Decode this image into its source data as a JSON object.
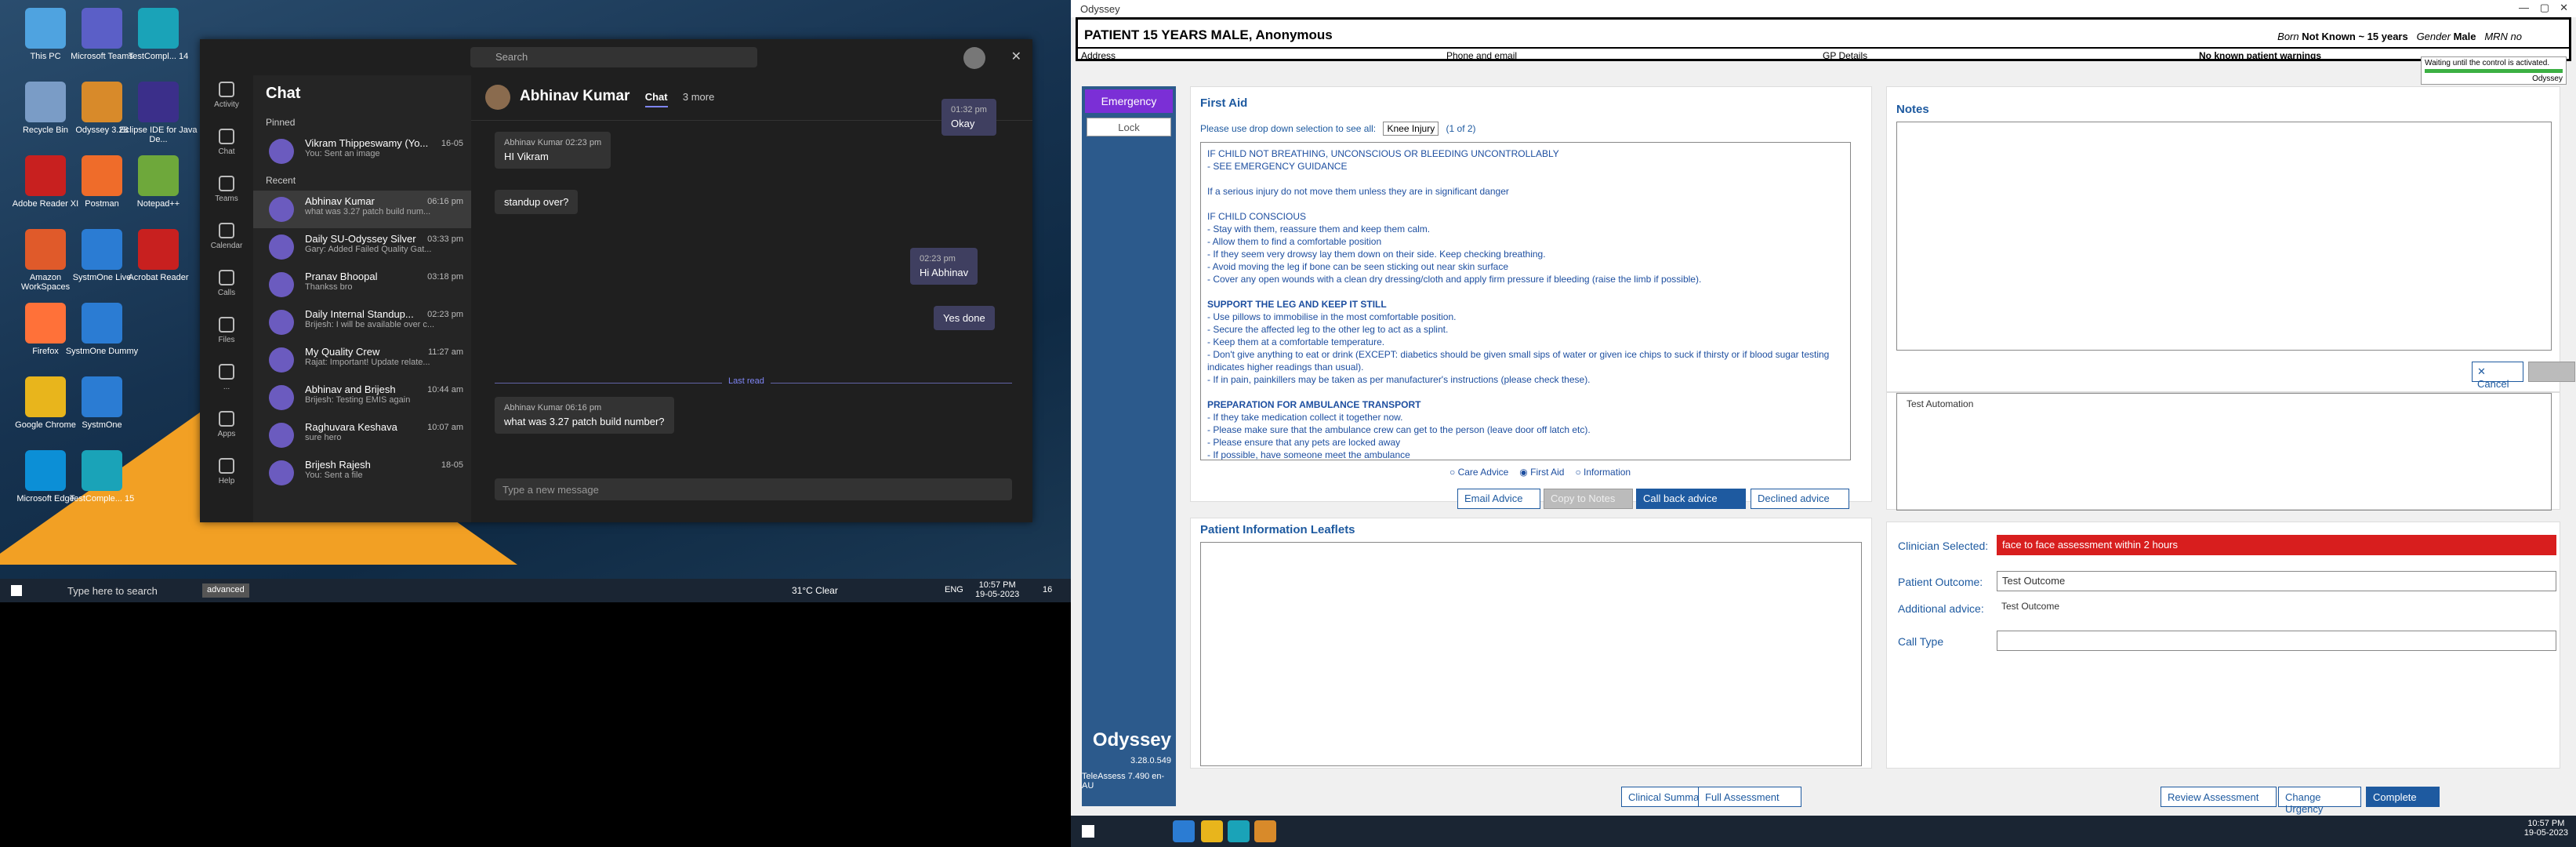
{
  "desktop": {
    "icons": [
      {
        "label": "This PC",
        "color": "#4fa3e0"
      },
      {
        "label": "Microsoft Teams",
        "color": "#5b5fc7"
      },
      {
        "label": "TestCompl... 14",
        "color": "#1aa3b8"
      },
      {
        "label": "Recycle Bin",
        "color": "#7a9cc6"
      },
      {
        "label": "Odyssey 3.28",
        "color": "#d88a2a"
      },
      {
        "label": "Eclipse IDE for Java De...",
        "color": "#3b2f8a"
      },
      {
        "label": "Adobe Reader XI",
        "color": "#c8201f"
      },
      {
        "label": "Postman",
        "color": "#ef6c2a"
      },
      {
        "label": "Notepad++",
        "color": "#6ea83b"
      },
      {
        "label": "Amazon WorkSpaces",
        "color": "#e05a2a"
      },
      {
        "label": "SystmOne Live",
        "color": "#2b7cd3"
      },
      {
        "label": "Acrobat Reader",
        "color": "#c8201f"
      },
      {
        "label": "Firefox",
        "color": "#ff7139"
      },
      {
        "label": "SystmOne Dummy",
        "color": "#2b7cd3"
      },
      {
        "label": "Google Chrome",
        "color": "#e8b51c"
      },
      {
        "label": "SystmOne",
        "color": "#2b7cd3"
      },
      {
        "label": "Microsoft Edge",
        "color": "#0c8fd6"
      },
      {
        "label": "TestComple... 15",
        "color": "#1aa3b8"
      }
    ]
  },
  "teams": {
    "search": "Search",
    "rail": [
      "Activity",
      "Chat",
      "Teams",
      "Calendar",
      "Calls",
      "Files",
      "...",
      "Apps",
      "Help"
    ],
    "chat_title": "Chat",
    "pinned": "Pinned",
    "recent": "Recent",
    "pinned_items": [
      {
        "name": "Vikram Thippeswamy (Yo...",
        "time": "16-05",
        "preview": "You: Sent an image"
      }
    ],
    "recent_items": [
      {
        "name": "Abhinav Kumar",
        "time": "06:16 pm",
        "preview": "what was 3.27 patch build num..."
      },
      {
        "name": "Daily SU-Odyssey Silver",
        "time": "03:33 pm",
        "preview": "Gary: Added Failed Quality Gat..."
      },
      {
        "name": "Pranav Bhoopal",
        "time": "03:18 pm",
        "preview": "Thankss bro"
      },
      {
        "name": "Daily Internal Standup...",
        "time": "02:23 pm",
        "preview": "Brijesh: I will be available over c..."
      },
      {
        "name": "My Quality Crew",
        "time": "11:27 am",
        "preview": "Rajat: Important! Update relate..."
      },
      {
        "name": "Abhinav and Brijesh",
        "time": "10:44 am",
        "preview": "Brijesh: Testing EMIS again"
      },
      {
        "name": "Raghuvara Keshava",
        "time": "10:07 am",
        "preview": "sure hero"
      },
      {
        "name": "Brijesh Rajesh",
        "time": "18-05",
        "preview": "You: Sent a file"
      }
    ],
    "header": {
      "name": "Abhinav Kumar",
      "tab": "Chat",
      "more": "3 more"
    },
    "messages": [
      {
        "meta": "01:32 pm",
        "text": "Okay",
        "me": true
      },
      {
        "meta": "Abhinav Kumar  02:23 pm",
        "text": "HI Vikram"
      },
      {
        "meta": "",
        "text": "standup over?"
      },
      {
        "meta": "02:23 pm",
        "text": "Hi Abhinav",
        "me": true
      },
      {
        "meta": "",
        "text": "Yes done",
        "me": true
      },
      {
        "meta": "Abhinav Kumar  06:16 pm",
        "text": "what was 3.27 patch build number?"
      }
    ],
    "last_read": "Last read",
    "compose": "Type a new message"
  },
  "taskbar": {
    "search": "Type here to search",
    "advanced": "advanced",
    "weather": "31°C  Clear",
    "lang": "ENG",
    "time": "10:57 PM",
    "date": "19-05-2023",
    "badge": "16"
  },
  "odyssey": {
    "window_title": "Odyssey",
    "patient": "PATIENT 15 YEARS MALE, Anonymous",
    "born_label": "Born",
    "born": "Not Known ~ 15 years",
    "gender_label": "Gender",
    "gender": "Male",
    "mrn": "MRN no",
    "address": "Address",
    "phone": "Phone and email",
    "gp": "GP Details",
    "warnings": "No known patient warnings",
    "tooltip": "Waiting until the control is activated.",
    "tooltip_sub": "Odyssey",
    "emergency": "Emergency",
    "lock": "Lock",
    "brand": "Odyssey",
    "version": "3.28.0.549",
    "teleassess": "TeleAssess 7.490 en-AU",
    "first_aid": {
      "title": "First Aid",
      "prompt": "Please use drop down selection to see all:",
      "dropdown": "Knee Injury",
      "count": "(1 of 2)",
      "lines": [
        {
          "t": "IF CHILD NOT BREATHING, UNCONSCIOUS OR BLEEDING UNCONTROLLABLY",
          "b": false
        },
        {
          "t": "  - SEE EMERGENCY GUIDANCE",
          "b": false
        },
        {
          "t": "",
          "b": false
        },
        {
          "t": "If a serious injury do not move them unless they are in significant danger",
          "b": false
        },
        {
          "t": "",
          "b": false
        },
        {
          "t": "IF CHILD CONSCIOUS",
          "b": false
        },
        {
          "t": "- Stay with them, reassure them and keep them calm.",
          "b": false
        },
        {
          "t": "- Allow them to find a comfortable position",
          "b": false
        },
        {
          "t": "- If they seem very drowsy lay them down on their side. Keep checking breathing.",
          "b": false
        },
        {
          "t": "- Avoid moving the leg if bone can be seen sticking out near skin surface",
          "b": false
        },
        {
          "t": "- Cover any open wounds with a clean dry dressing/cloth and apply firm pressure if bleeding (raise the limb if possible).",
          "b": false
        },
        {
          "t": "",
          "b": false
        },
        {
          "t": "SUPPORT THE LEG AND KEEP IT STILL",
          "b": true
        },
        {
          "t": "- Use pillows to immobilise in the most comfortable position.",
          "b": false
        },
        {
          "t": "- Secure the affected leg to the other leg to act as a splint.",
          "b": false
        },
        {
          "t": "- Keep them at a comfortable temperature.",
          "b": false
        },
        {
          "t": "- Don't give anything to eat or drink (EXCEPT: diabetics should be given small sips of water or given ice chips to suck if thirsty or if blood sugar testing",
          "b": false
        },
        {
          "t": "indicates higher readings than usual).",
          "b": false
        },
        {
          "t": "- If in pain, painkillers may be taken as per manufacturer's instructions (please check these).",
          "b": false
        },
        {
          "t": "",
          "b": false
        },
        {
          "t": "PREPARATION FOR AMBULANCE TRANSPORT",
          "b": true
        },
        {
          "t": "- If they take medication collect it together now.",
          "b": false
        },
        {
          "t": "- Please make sure that the ambulance crew can get to the person (leave door off latch etc).",
          "b": false
        },
        {
          "t": "- Please ensure that any pets are locked away",
          "b": false
        },
        {
          "t": "- If possible, have someone meet the ambulance",
          "b": false
        }
      ],
      "radios": [
        "Care Advice",
        "First Aid",
        "Information"
      ],
      "buttons": [
        "Email Advice",
        "Copy to Notes",
        "Call back advice",
        "Declined advice"
      ]
    },
    "leaflets_title": "Patient Information Leaflets",
    "notes_title": "Notes",
    "cancel": "Cancel",
    "automation": "Test Automation",
    "clinician_label": "Clinician Selected:",
    "clinician_value": "face to face assessment within 2 hours",
    "outcome_label": "Patient Outcome:",
    "outcome_value": "Test Outcome",
    "additional_label": "Additional advice:",
    "additional_value": "Test Outcome",
    "calltype_label": "Call Type",
    "bottom_buttons": [
      "Clinical Summary",
      "Full Assessment",
      "Review Assessment",
      "Change Urgency",
      "Complete"
    ],
    "time": "10:57 PM",
    "date": "19-05-2023"
  }
}
